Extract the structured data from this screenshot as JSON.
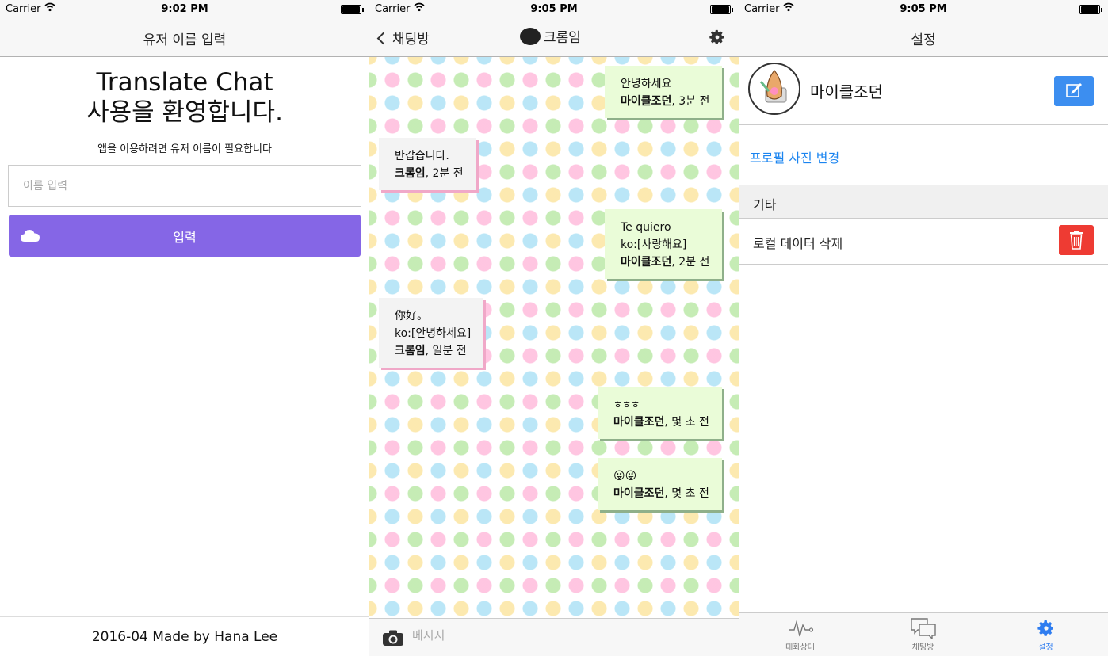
{
  "screen1": {
    "status": {
      "carrier": "Carrier",
      "time": "9:02 PM"
    },
    "nav_title": "유저 이름 입력",
    "welcome_line1": "Translate Chat",
    "welcome_line2": "사용을 환영합니다.",
    "subtext": "앱을 이용하려면 유저 이름이 필요합니다",
    "input_placeholder": "이름 입력",
    "submit_label": "입력",
    "footer": "2016-04 Made by Hana Lee",
    "accent": "#8566e6"
  },
  "screen2": {
    "status": {
      "carrier": "Carrier",
      "time": "9:05 PM"
    },
    "back_label": "채팅방",
    "title": "크롬임",
    "messages": [
      {
        "side": "right",
        "lines": [
          "안녕하세요"
        ],
        "sender": "마이클조던",
        "time": ", 3분 전"
      },
      {
        "side": "left",
        "lines": [
          "반갑습니다."
        ],
        "sender": "크롬임",
        "time": ", 2분 전"
      },
      {
        "side": "right",
        "lines": [
          "Te quiero",
          "ko:[사랑해요]"
        ],
        "sender": "마이클조던",
        "time": ", 2분 전"
      },
      {
        "side": "left",
        "lines": [
          "你好。",
          "ko:[안녕하세요]"
        ],
        "sender": "크롬임",
        "time": ", 일분 전"
      },
      {
        "side": "right",
        "lines": [
          "ㅎㅎㅎ"
        ],
        "sender": "마이클조던",
        "time": ", 몇 초 전"
      },
      {
        "side": "right",
        "lines": [
          "😜😜"
        ],
        "sender": "마이클조던",
        "time": ", 몇 초 전"
      }
    ],
    "input_placeholder": "메시지"
  },
  "screen3": {
    "status": {
      "carrier": "Carrier",
      "time": "9:05 PM"
    },
    "nav_title": "설정",
    "profile_name": "마이클조던",
    "change_photo": "프로필 사진 변경",
    "section_header": "기타",
    "delete_label": "로컬 데이터 삭제",
    "tabs": [
      {
        "label": "대화상대",
        "icon": "pulse-icon",
        "active": false
      },
      {
        "label": "채팅방",
        "icon": "chat-bubbles-icon",
        "active": false
      },
      {
        "label": "설정",
        "icon": "gear-icon",
        "active": true
      }
    ],
    "link_color": "#1a84f0",
    "delete_color": "#ee3b33",
    "edit_color": "#3c8ef0"
  }
}
